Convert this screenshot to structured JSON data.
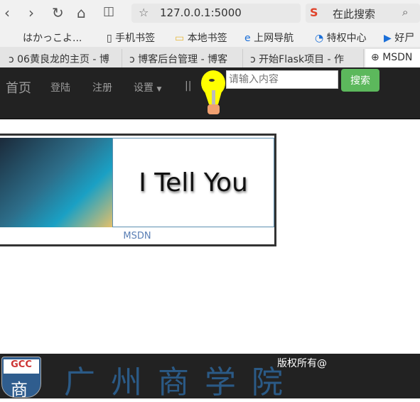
{
  "browser": {
    "url": "127.0.0.1:5000",
    "search_placeholder": "在此搜索",
    "bookmarks": [
      "はかっこよ...",
      "手机书签",
      "本地书签",
      "上网导航",
      "特权中心",
      "好尸"
    ],
    "tabs": [
      "06黄良龙的主页 - 博",
      "博客后台管理 - 博客",
      "开始Flask项目 - 作",
      "MSDN"
    ]
  },
  "nav": {
    "items": [
      "首页",
      "登陆",
      "注册",
      "设置",
      "||"
    ],
    "search_placeholder": "请输入内容",
    "search_button": "搜索",
    "accent": "#5cb85c"
  },
  "card": {
    "banner_text": "I Tell You",
    "caption": "MSDN"
  },
  "footer": {
    "logo_text": "GCC",
    "school_name": "广州商学院",
    "copyright": "版权所有@"
  }
}
